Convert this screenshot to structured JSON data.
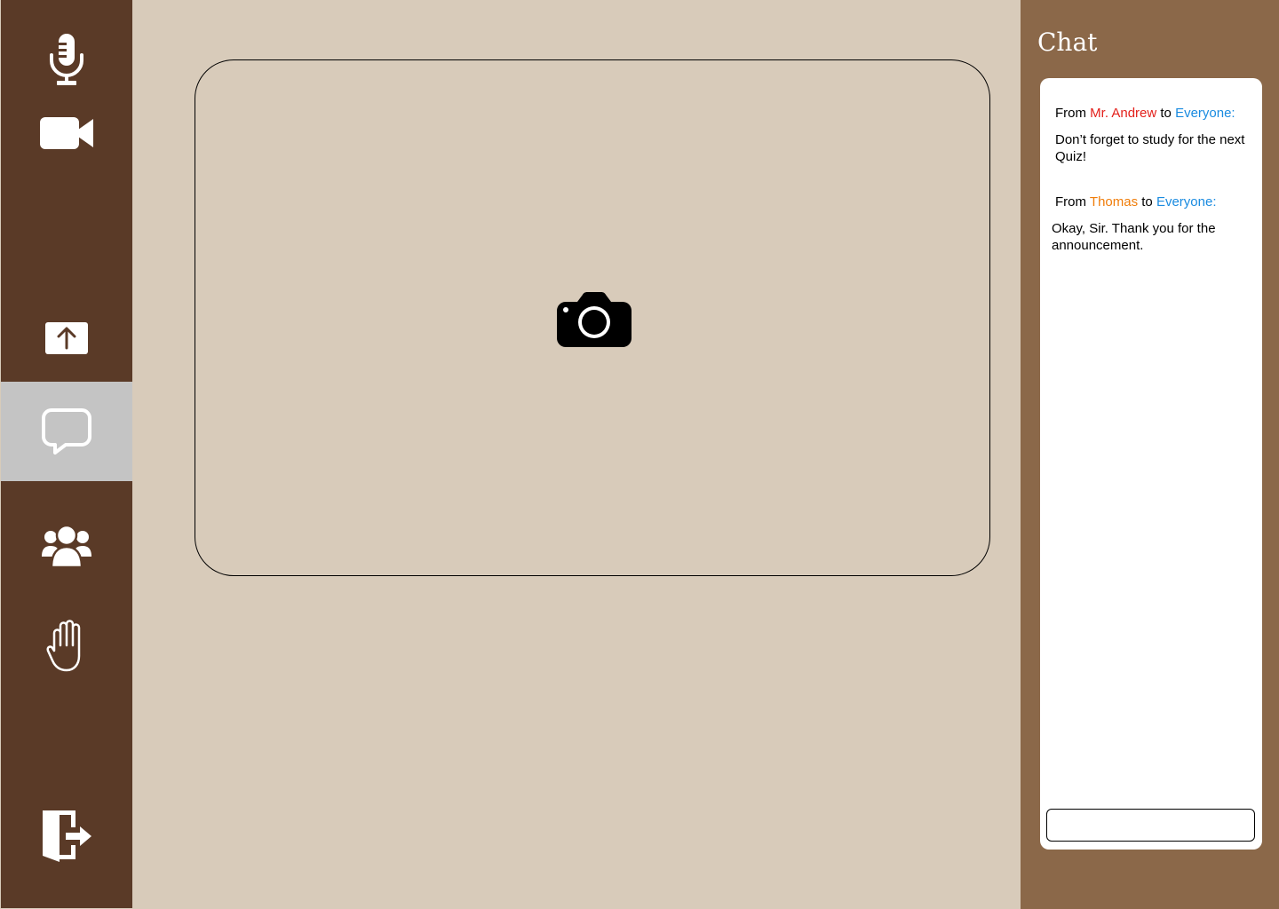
{
  "sidebar": {
    "items": [
      {
        "name": "microphone",
        "icon": "microphone-icon"
      },
      {
        "name": "video-camera",
        "icon": "video-camera-icon"
      },
      {
        "name": "share-screen",
        "icon": "upload-arrow-icon"
      },
      {
        "name": "chat",
        "icon": "speech-bubble-icon",
        "active": true
      },
      {
        "name": "participants",
        "icon": "people-group-icon"
      },
      {
        "name": "raise-hand",
        "icon": "hand-icon"
      },
      {
        "name": "leave",
        "icon": "exit-door-icon"
      }
    ]
  },
  "main": {
    "video_placeholder_icon": "camera-icon"
  },
  "chat": {
    "title": "Chat",
    "messages": [
      {
        "from_label": "From",
        "sender": "Mr. Andrew",
        "to_label": "to",
        "recipient": "Everyone:",
        "text": "Don’t forget to study for the next Quiz!"
      },
      {
        "from_label": "From",
        "sender": "Thomas",
        "to_label": "to",
        "recipient": "Everyone:",
        "text": "Okay, Sir. Thank you for the announcement."
      }
    ],
    "input": {
      "value": "",
      "placeholder": ""
    }
  },
  "colors": {
    "sidebar_bg": "#5a3a27",
    "main_bg": "#d8cbba",
    "chat_panel_bg": "#8b6849",
    "active_item_bg": "#c4c4c4",
    "sender_a": "#e3201b",
    "sender_b": "#f07d0a",
    "recipient": "#1a8be0"
  }
}
